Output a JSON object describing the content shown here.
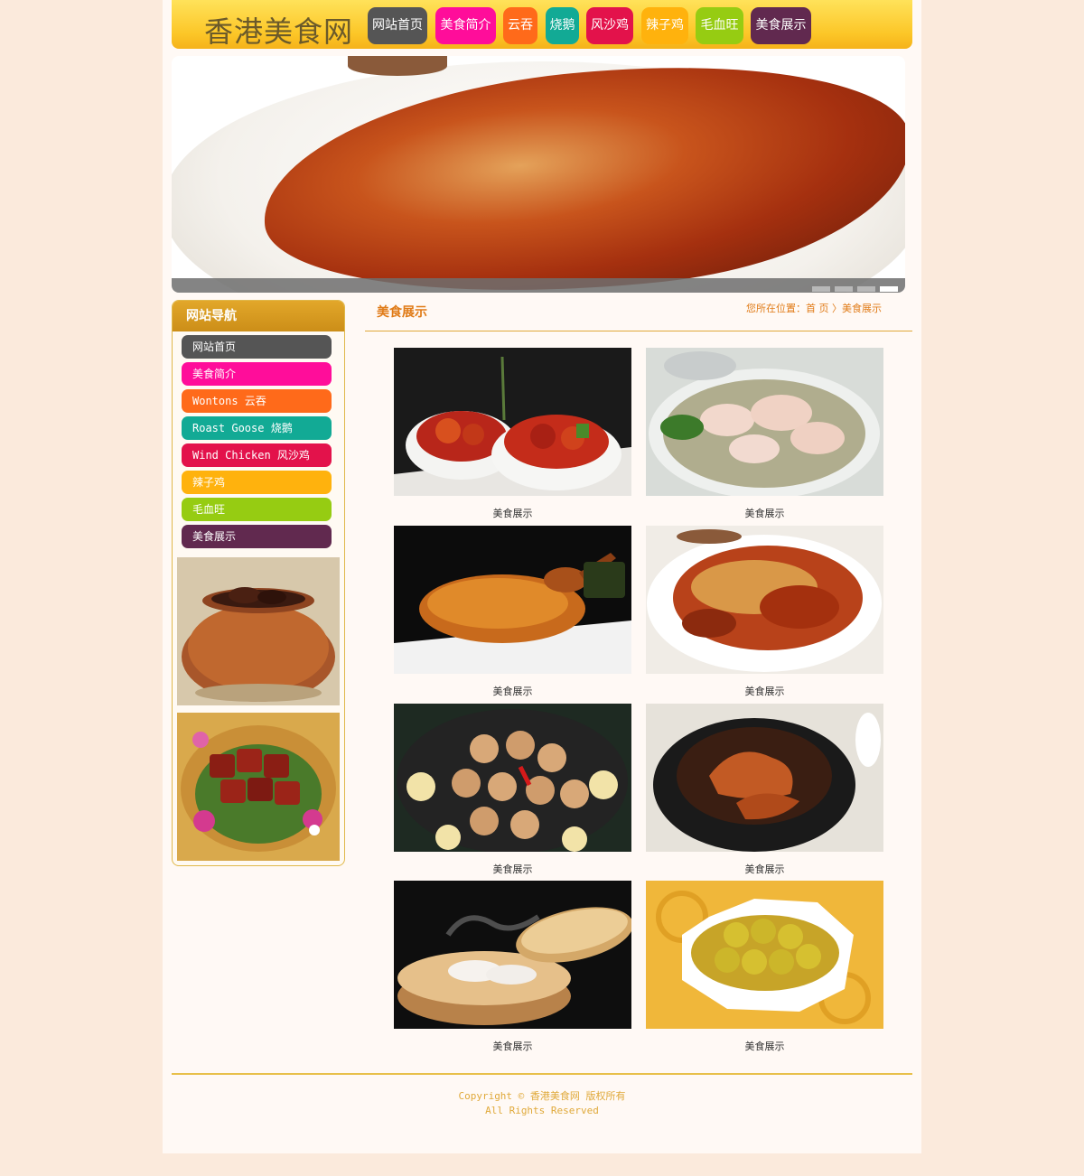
{
  "header": {
    "logo": "香港美食网",
    "nav": [
      {
        "label": "网站首页",
        "color": "#555555"
      },
      {
        "label": "美食简介",
        "color": "#ff0d9a"
      },
      {
        "label": "云吞",
        "color": "#ff6a1a"
      },
      {
        "label": "烧鹅",
        "color": "#12aa95"
      },
      {
        "label": "风沙鸡",
        "color": "#e3124b"
      },
      {
        "label": "辣子鸡",
        "color": "#ffb20d"
      },
      {
        "label": "毛血旺",
        "color": "#96cc12"
      },
      {
        "label": "美食展示",
        "color": "#61294f"
      }
    ]
  },
  "banner": {
    "slides": 4,
    "active_slide": 4
  },
  "sidebar": {
    "title": "网站导航",
    "items": [
      {
        "label": "网站首页",
        "color": "#555555"
      },
      {
        "label": "美食简介",
        "color": "#ff0d9a"
      },
      {
        "label": "Wontons 云吞",
        "color": "#ff6a1a"
      },
      {
        "label": "Roast Goose 烧鹅",
        "color": "#12aa95"
      },
      {
        "label": "Wind Chicken 风沙鸡",
        "color": "#e3124b"
      },
      {
        "label": "辣子鸡",
        "color": "#ffb20d"
      },
      {
        "label": "毛血旺",
        "color": "#96cc12"
      },
      {
        "label": "美食展示",
        "color": "#61294f"
      }
    ]
  },
  "main": {
    "title": "美食展示",
    "breadcrumb": "您所在位置：首 页 〉美食展示",
    "gallery": [
      {
        "caption": "美食展示",
        "image": "sweet-sour-pork"
      },
      {
        "caption": "美食展示",
        "image": "wonton-soup"
      },
      {
        "caption": "美食展示",
        "image": "roast-goose-whole"
      },
      {
        "caption": "美食展示",
        "image": "wind-chicken"
      },
      {
        "caption": "美食展示",
        "image": "fried-balls"
      },
      {
        "caption": "美食展示",
        "image": "chicken-feet-pot"
      },
      {
        "caption": "美食展示",
        "image": "steamed-dumplings"
      },
      {
        "caption": "美食展示",
        "image": "fish-balls-curry"
      }
    ]
  },
  "footer": {
    "copyright": "Copyright © 香港美食网 版权所有",
    "rights": "All Rights Reserved"
  }
}
